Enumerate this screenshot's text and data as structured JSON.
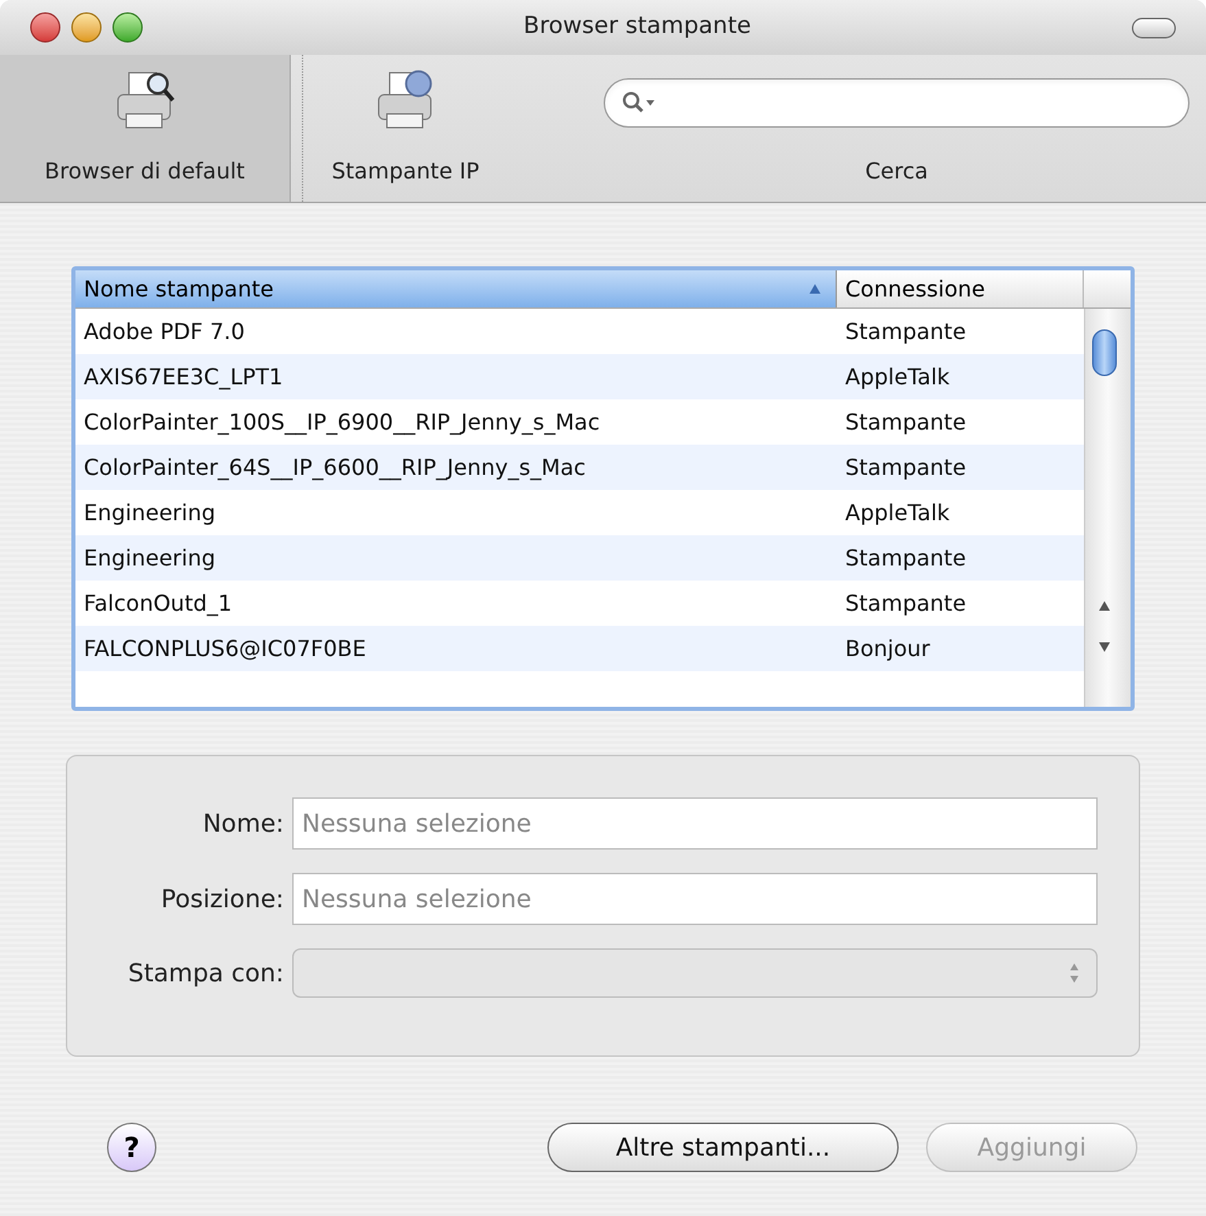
{
  "window": {
    "title": "Browser stampante"
  },
  "toolbar": {
    "items": [
      {
        "kind": "default",
        "label": "Browser di default",
        "selected": true
      },
      {
        "kind": "ip",
        "label": "Stampante IP",
        "selected": false
      }
    ],
    "search": {
      "label": "Cerca"
    }
  },
  "table": {
    "columns": [
      {
        "label": "Nome stampante",
        "sorted": true
      },
      {
        "label": "Connessione",
        "sorted": false
      }
    ],
    "rows": [
      {
        "name": "Adobe PDF 7.0",
        "connection": "Stampante"
      },
      {
        "name": "AXIS67EE3C_LPT1",
        "connection": "AppleTalk"
      },
      {
        "name": "ColorPainter_100S__IP_6900__RIP_Jenny_s_Mac",
        "connection": "Stampante"
      },
      {
        "name": "ColorPainter_64S__IP_6600__RIP_Jenny_s_Mac",
        "connection": "Stampante"
      },
      {
        "name": "Engineering",
        "connection": "AppleTalk"
      },
      {
        "name": "Engineering",
        "connection": "Stampante"
      },
      {
        "name": "FalconOutd_1",
        "connection": "Stampante"
      },
      {
        "name": "FALCONPLUS6@IC07F0BE",
        "connection": "Bonjour"
      }
    ]
  },
  "details": {
    "fields": [
      {
        "kind": "text",
        "label": "Nome:",
        "placeholder": "Nessuna selezione"
      },
      {
        "kind": "text",
        "label": "Posizione:",
        "placeholder": "Nessuna selezione"
      },
      {
        "kind": "popup",
        "label": "Stampa con:",
        "disabled": true
      }
    ]
  },
  "help": {
    "label": "?"
  },
  "buttons": [
    {
      "label": "Altre stampanti...",
      "disabled": false
    },
    {
      "label": "Aggiungi",
      "disabled": true
    }
  ]
}
